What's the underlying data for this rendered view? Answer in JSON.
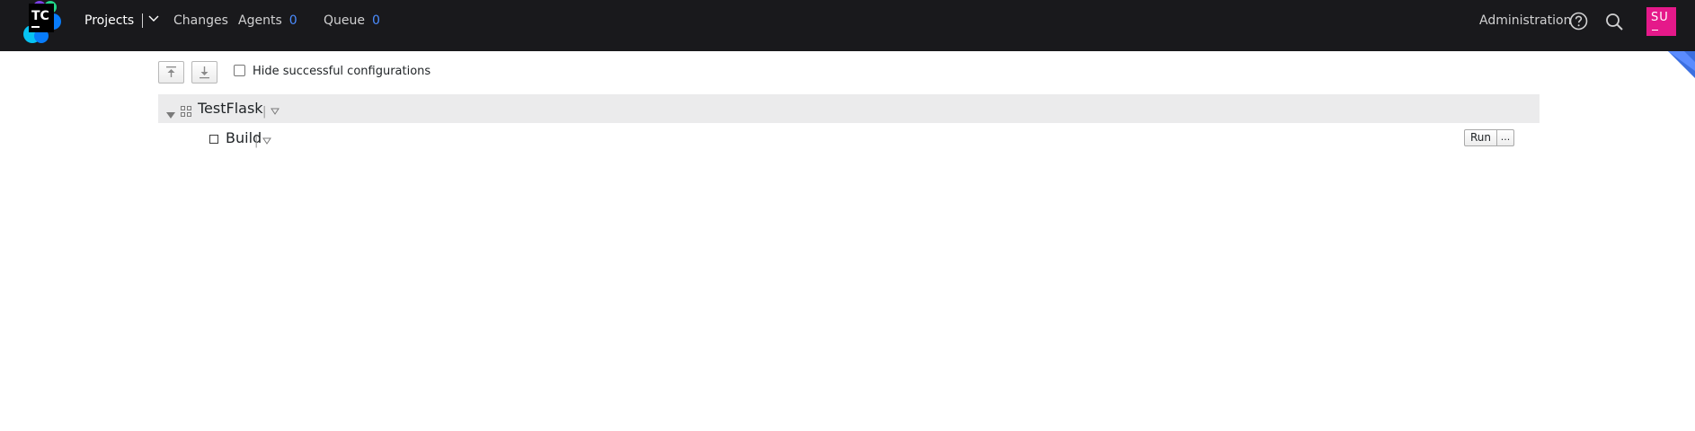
{
  "header": {
    "logo_text": "TC",
    "nav": {
      "projects_label": "Projects",
      "changes_label": "Changes",
      "agents_label": "Agents",
      "agents_count": "0",
      "queue_label": "Queue",
      "queue_count": "0"
    },
    "administration_label": "Administration",
    "help_icon": "help-circle-icon",
    "search_icon": "search-icon",
    "avatar_initials": "SU",
    "avatar_color": "#e5198a"
  },
  "toolbar": {
    "collapse_all_icon": "collapse-all-icon",
    "expand_all_icon": "expand-all-icon",
    "hide_successful_label": "Hide successful configurations",
    "hide_successful_checked": false
  },
  "projects": [
    {
      "name": "TestFlask",
      "expanded": true,
      "build_configurations": [
        {
          "name": "Build",
          "run_label": "Run",
          "more_label": "..."
        }
      ]
    }
  ],
  "colors": {
    "header_bg": "#19191c",
    "accent_blue": "#4b8cff",
    "project_row_bg": "#ebebec"
  }
}
